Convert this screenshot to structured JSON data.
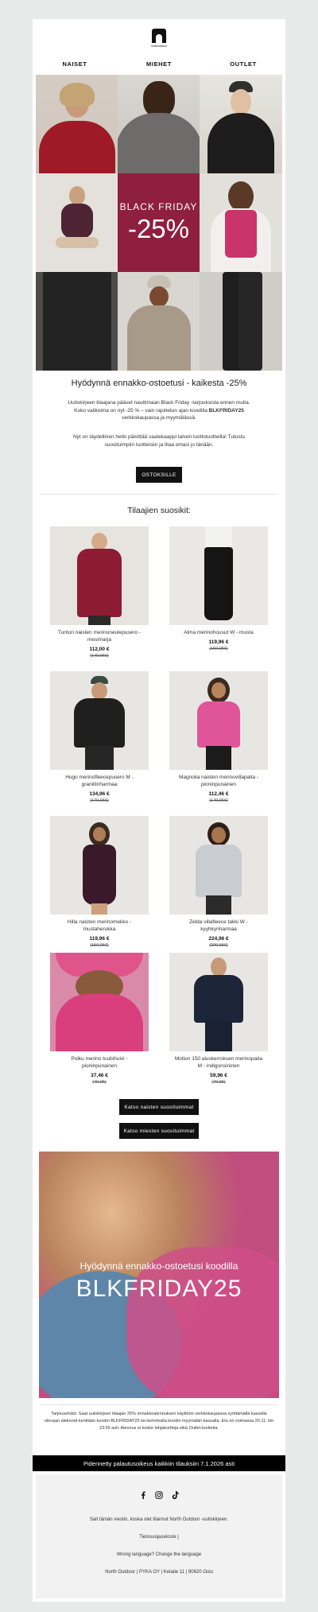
{
  "brand": {
    "logo_text": "northoutdoor"
  },
  "nav": [
    "NAISET",
    "MIEHET",
    "OUTLET"
  ],
  "hero": {
    "line1": "BLACK FRIDAY",
    "line2": "-25%",
    "accent": "#8e1f3e"
  },
  "intro": {
    "heading": "Hyödynnä ennakko-ostoetusi - kaikesta -25%",
    "p1_before": "Uutiskirjeen tilaajana pääset nauttimaan Black Friday -tarjouksista ennen muita. Koko valikoima on nyt -25 % – vain rajoitetun ajan koodilla ",
    "p1_code": "BLKFRIDAY25",
    "p1_after": " verkkokaupassa ja myymälässä.",
    "p2": "Nyt on täydellinen hetki päivittää vaatekaappi talven luottotuotteilla! Tutustu suosituimpiin tuotteisiin ja tilaa omasi jo tänään.",
    "cta": "OSTOKSILLE"
  },
  "favorites": {
    "heading": "Tilaajien suosikit:",
    "products": [
      {
        "name": "Tunturi naisten merinoneulepusero - mesimarja",
        "price": "112,00 €",
        "old": "(149,95€)"
      },
      {
        "name": "Alma merinohousut W - musta",
        "price": "119,96 €",
        "old": "(159,95€)"
      },
      {
        "name": "Hugo merinofleecepusero M - graniitinharmaa",
        "price": "134,96 €",
        "old": "(179,95€)"
      },
      {
        "name": "Magnolia naisten merinovillapaita - pioninpunainen",
        "price": "112,46 €",
        "old": "(149,95€)"
      },
      {
        "name": "Hilla naisten merinomekko - mustaherukka",
        "price": "119,96 €",
        "old": "(159,95€)"
      },
      {
        "name": "Zelda villafleece takki W - kyyhkynharmaa",
        "price": "224,96 €",
        "old": "(299,95€)"
      },
      {
        "name": "Polku merino tuubihuivi - pioninpunainen",
        "price": "37,46 €",
        "old": "(49,95)"
      },
      {
        "name": "Motion 150 aluskerroksen merinopaita M - indigonsininen",
        "price": "59,96 €",
        "old": "(79,95)"
      }
    ],
    "btn_women": "Katso naisten suosituimmat",
    "btn_men": "Katso miesten suosituimmat"
  },
  "promo": {
    "line1": "Hyödynnä ennakko-ostoetusi koodilla",
    "code": "BLKFRIDAY25"
  },
  "terms": "Tarjousehdot: Saat uutiskirjeen tilaajan 25% ennakkoalennuksen käyttöön verkkokaupassa syöttämällä kassalla olevaan alekoodi-kenttään koodin BLKFRIDAY25 tai kertomalla koodin myymälän kassalla. Etu on voimassa 20.11. klo 23:59 asti. Alennus ei koske lahjakortteja eikä Outlet-tuotteita.",
  "return_bar": "Pidennetty palautusoikeus kaikkiin tilauksiin 7.1.2026 asti",
  "footer": {
    "social": [
      "facebook-icon",
      "instagram-icon",
      "tiktok-icon"
    ],
    "received": "Sait tämän viestin, koska olet tilannut North Outdoor -uutiskirjeen.",
    "privacy": "Tietosuojaseloste |",
    "language": "Wrong language? Change the language",
    "address": "North Outdoor | PYKA OY | Kelatie 11 | 90620 Oulu"
  }
}
